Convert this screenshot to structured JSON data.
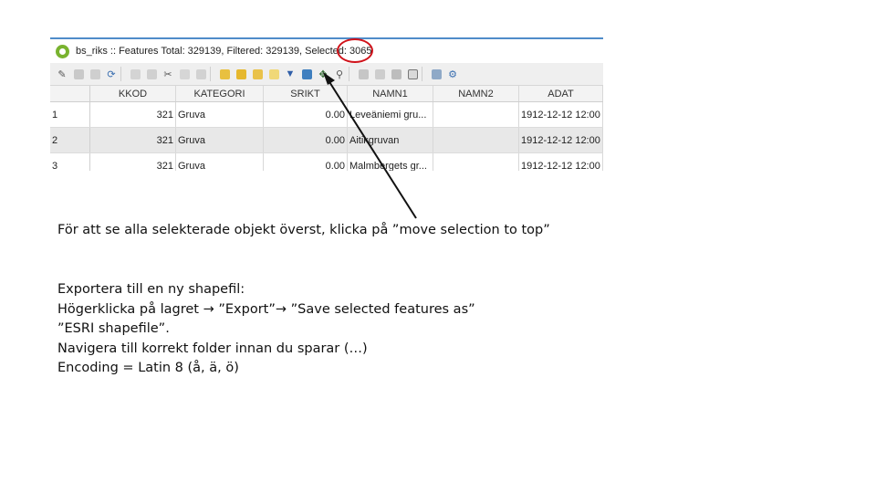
{
  "window": {
    "title_prefix": "bs_riks :: Features Total: 329139, Filtered: 329139, Selected: ",
    "selected_count": "3065"
  },
  "toolbar": {
    "icons": [
      "pencil-icon",
      "save-icon",
      "delete-icon",
      "reload-icon",
      "add-feature-icon",
      "delete-feature-icon",
      "cut-icon",
      "copy-icon",
      "paste-icon",
      "select-by-expression-icon",
      "select-all-icon",
      "invert-selection-icon",
      "deselect-icon",
      "filter-icon",
      "move-selection-to-top-icon",
      "pan-to-selection-icon",
      "zoom-to-selection-icon",
      "copy-rows-icon",
      "delete-rows-icon",
      "field-calculator-icon",
      "conditional-format-icon",
      "table-view-icon",
      "form-view-icon",
      "actions-icon"
    ]
  },
  "table": {
    "columns": [
      "",
      "KKOD",
      "KATEGORI",
      "SRIKT",
      "NAMN1",
      "NAMN2",
      "ADAT"
    ],
    "rows": [
      [
        "1",
        "321",
        "Gruva",
        "0.00",
        "Leveäniemi gru...",
        "",
        "1912-12-12 12:00"
      ],
      [
        "2",
        "321",
        "Gruva",
        "0.00",
        "Aitikgruvan",
        "",
        "1912-12-12 12:00"
      ],
      [
        "3",
        "321",
        "Gruva",
        "0.00",
        "Malmbergets gr...",
        "",
        "1912-12-12 12:00"
      ]
    ]
  },
  "instructions": {
    "line1": "För att se alla selekterade objekt överst, klicka på ”move selection to top”",
    "line2": "Exportera till en ny shapefil:",
    "line3_a": "Högerklicka på lagret ",
    "line3_b": " ”Export”",
    "line3_c": " ”Save selected features as”",
    "line4": "”ESRI shapefile”.",
    "line5": "Navigera till korrekt folder innan du sparar (…)",
    "line6": "Encoding = Latin 8 (å, ä, ö)"
  },
  "colors": {
    "highlight": "#d0121a",
    "qgis_green": "#79b32f"
  }
}
